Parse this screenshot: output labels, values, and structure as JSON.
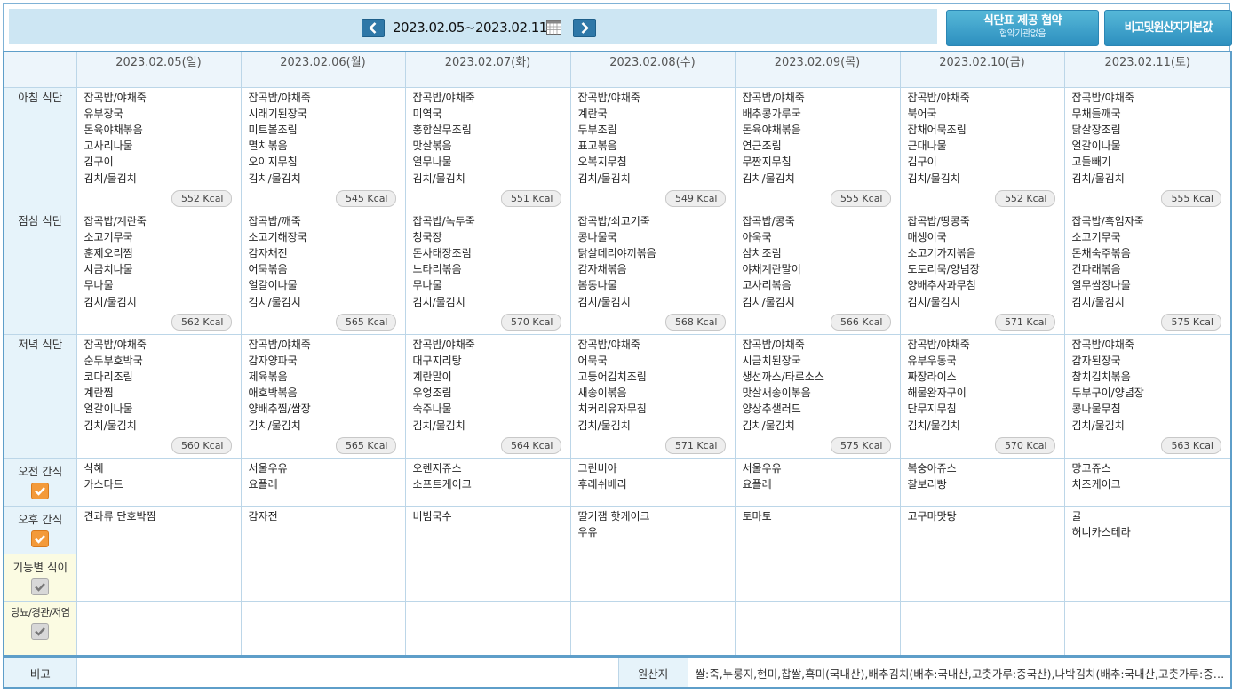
{
  "header": {
    "date_range": "2023.02.05~2023.02.11",
    "btn_agree_title": "식단표 제공 협약",
    "btn_agree_sub": "협약기관없음",
    "btn_remark": "비고및원산지기본값"
  },
  "days": [
    "2023.02.05(일)",
    "2023.02.06(월)",
    "2023.02.07(화)",
    "2023.02.08(수)",
    "2023.02.09(목)",
    "2023.02.10(금)",
    "2023.02.11(토)"
  ],
  "rows": {
    "breakfast": "아침 식단",
    "lunch": "점심 식단",
    "dinner": "저녁 식단",
    "am_snack": "오전 간식",
    "pm_snack": "오후 간식",
    "functional": "기능별 식이",
    "diet": "당뇨/경관/저염"
  },
  "breakfast": [
    {
      "items": [
        "잡곡밥/야채죽",
        "유부장국",
        "돈육야채볶음",
        "고사리나물",
        "김구이",
        "김치/물김치"
      ],
      "kcal": "552 Kcal"
    },
    {
      "items": [
        "잡곡밥/야채죽",
        "시래기된장국",
        "미트볼조림",
        "멸치볶음",
        "오이지무침",
        "김치/물김치"
      ],
      "kcal": "545 Kcal"
    },
    {
      "items": [
        "잡곡밥/야채죽",
        "미역국",
        "홍합살무조림",
        "맛살볶음",
        "열무나물",
        "김치/물김치"
      ],
      "kcal": "551 Kcal"
    },
    {
      "items": [
        "잡곡밥/야채죽",
        "계란국",
        "두부조림",
        "표고볶음",
        "오복지무침",
        "김치/물김치"
      ],
      "kcal": "549 Kcal"
    },
    {
      "items": [
        "잡곡밥/야채죽",
        "배추콩가루국",
        "돈육야채볶음",
        "연근조림",
        "무짠지무침",
        "김치/물김치"
      ],
      "kcal": "555 Kcal"
    },
    {
      "items": [
        "잡곡밥/야채죽",
        "북어국",
        "잡채어묵조림",
        "근대나물",
        "김구이",
        "김치/물김치"
      ],
      "kcal": "552 Kcal"
    },
    {
      "items": [
        "잡곡밥/야채죽",
        "무채들깨국",
        "닭살장조림",
        "얼갈이나물",
        "고들빼기",
        "김치/물김치"
      ],
      "kcal": "555 Kcal"
    }
  ],
  "lunch": [
    {
      "items": [
        "잡곡밥/계란죽",
        "소고기무국",
        "훈제오리찜",
        "시금치나물",
        "무나물",
        "김치/물김치"
      ],
      "kcal": "562 Kcal"
    },
    {
      "items": [
        "잡곡밥/깨죽",
        "소고기해장국",
        "감자채전",
        "어묵볶음",
        "얼갈이나물",
        "김치/물김치"
      ],
      "kcal": "565 Kcal"
    },
    {
      "items": [
        "잡곡밥/녹두죽",
        "청국장",
        "돈사태장조림",
        "느타리볶음",
        "무나물",
        "김치/물김치"
      ],
      "kcal": "570 Kcal"
    },
    {
      "items": [
        "잡곡밥/쇠고기죽",
        "콩나물국",
        "닭살데리야끼볶음",
        "감자채볶음",
        "봄동나물",
        "김치/물김치"
      ],
      "kcal": "568 Kcal"
    },
    {
      "items": [
        "잡곡밥/콩죽",
        "아욱국",
        "삼치조림",
        "야채계란말이",
        "고사리볶음",
        "김치/물김치"
      ],
      "kcal": "566 Kcal"
    },
    {
      "items": [
        "잡곡밥/땅콩죽",
        "매생이국",
        "소고기가지볶음",
        "도토리묵/양념장",
        "양배추사과무침",
        "김치/물김치"
      ],
      "kcal": "571 Kcal"
    },
    {
      "items": [
        "잡곡밥/흑임자죽",
        "소고기무국",
        "돈채숙주볶음",
        "건파래볶음",
        "열무쌈장나물",
        "김치/물김치"
      ],
      "kcal": "575 Kcal"
    }
  ],
  "dinner": [
    {
      "items": [
        "잡곡밥/야채죽",
        "순두부호박국",
        "코다리조림",
        "계란찜",
        "얼갈이나물",
        "김치/물김치"
      ],
      "kcal": "560 Kcal"
    },
    {
      "items": [
        "잡곡밥/야채죽",
        "감자양파국",
        "제육볶음",
        "애호박볶음",
        "양배추찜/쌈장",
        "김치/물김치"
      ],
      "kcal": "565 Kcal"
    },
    {
      "items": [
        "잡곡밥/야채죽",
        "대구지리탕",
        "계란말이",
        "우엉조림",
        "숙주나물",
        "김치/물김치"
      ],
      "kcal": "564 Kcal"
    },
    {
      "items": [
        "잡곡밥/야채죽",
        "어묵국",
        "고등어김치조림",
        "새송이볶음",
        "치커리유자무침",
        "김치/물김치"
      ],
      "kcal": "571 Kcal"
    },
    {
      "items": [
        "잡곡밥/야채죽",
        "시금치된장국",
        "생선까스/타르소스",
        "맛살새송이볶음",
        "양상추샐러드",
        "김치/물김치"
      ],
      "kcal": "575 Kcal"
    },
    {
      "items": [
        "잡곡밥/야채죽",
        "유부우동국",
        "짜장라이스",
        "해물완자구이",
        "단무지무침",
        "김치/물김치"
      ],
      "kcal": "570 Kcal"
    },
    {
      "items": [
        "잡곡밥/야채죽",
        "감자된장국",
        "참치김치볶음",
        "두부구이/양념장",
        "콩나물무침",
        "김치/물김치"
      ],
      "kcal": "563 Kcal"
    }
  ],
  "am_snack": [
    [
      "식혜",
      "카스타드"
    ],
    [
      "서울우유",
      "요플레"
    ],
    [
      "오렌지쥬스",
      "소프트케이크"
    ],
    [
      "그린비아",
      "후레쉬베리"
    ],
    [
      "서울우유",
      "요플레"
    ],
    [
      "복숭아쥬스",
      "찰보리빵"
    ],
    [
      "망고쥬스",
      "치즈케이크"
    ]
  ],
  "pm_snack": [
    [
      "견과류 단호박찜"
    ],
    [
      "감자전"
    ],
    [
      "비빔국수"
    ],
    [
      "딸기잼 핫케이크",
      "우유"
    ],
    [
      "토마토"
    ],
    [
      "고구마맛탕"
    ],
    [
      "귤",
      "허니카스테라"
    ]
  ],
  "bottom": {
    "remark_label": "비고",
    "remark_value": "",
    "origin_label": "원산지",
    "origin_value": "쌀:죽,누룽지,현미,찹쌀,흑미(국내산),배추김치(배추:국내산,고춧가루:중국산),나박김치(배추:국내산,고춧가루:중국산)"
  },
  "colors": {
    "border": "#5e9ec9",
    "label_bg": "#e6f3fa",
    "special_bg": "#fbfbe2",
    "button": "#3ea3cf",
    "sunday": "#d6212a",
    "saturday": "#2156c6",
    "check_on": "#f39a3a",
    "check_off": "#d8d8d8"
  },
  "icons": {
    "prev": "chevron-left-icon",
    "next": "chevron-right-icon",
    "calendar": "calendar-icon",
    "checkbox": "checkbox-icon"
  }
}
